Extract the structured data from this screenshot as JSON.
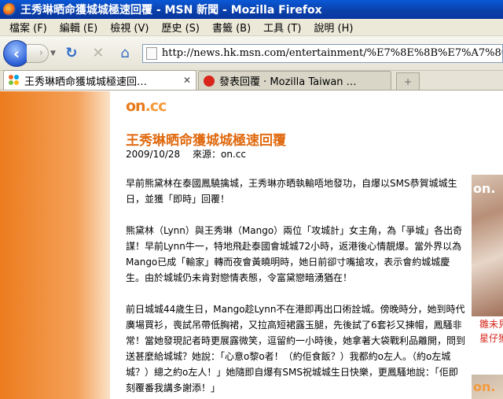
{
  "window": {
    "title": "王秀琳晒命獲城城極速回覆 - MSN 新聞 - Mozilla Firefox"
  },
  "menubar": {
    "items": [
      "檔案 (F)",
      "編輯 (E)",
      "檢視 (V)",
      "歷史 (S)",
      "書籤 (B)",
      "工具 (T)",
      "說明 (H)"
    ]
  },
  "navbar": {
    "url": "http://news.hk.msn.com/entertainment/%E7%8E%8B%E7%A7%80%E7"
  },
  "tabs": [
    {
      "label": "王秀琳晒命獲城城極速回…",
      "active": true
    },
    {
      "label": "發表回覆 · Mozilla Taiwan …",
      "active": false
    }
  ],
  "page": {
    "logo_on": "on",
    "logo_cc": ".cc",
    "title": "王秀琳晒命獲城城極速回覆",
    "date": "2009/10/28",
    "source_label": "來源：on.cc",
    "paragraphs": [
      "早前熊黛林在泰國鳳驍擒城，王秀琳亦晒執輸唔地發功，自爆以SMS恭賀城城生日，並獲「即時」回覆！",
      "熊黛林（Lynn）與王秀琳（Mango）兩位「攻城計」女主角，為「爭城」各出奇謀！早前Lynn牛一，特地飛赴泰國會城城72小時，返港後心情靚爆。當外界以為Mango已成「輸家」轉而夜會黃曉明時，她日前卻寸嘴搶攻，表示會約城城慶生。由於城城仍未肯對戀情表態，令富黛戀暗湧猶在！",
      "前日城城44歲生日，Mango趁Lynn不在港即再出口術詮城。傍晚時分，她到時代廣場買衫，喪試吊帶低胸裙，又拉高短裙露玉腿，先後試了6套衫又揀帽，鳳騷非常！當她發現記者時更展露微笑，逗留約一小時後，她拿著大袋戰利品離開，問到送甚麼給城城？她說：「心意o黎o者！（約佢食飯？）我都約o左人。（約o左城城？）總之約o左人！」她隨即自爆有SMS祝城城生日快樂，更鳳騷地說：「佢即刻覆番我講多謝添！」"
    ],
    "side_ad": {
      "logo": "on.",
      "caption_line1": "雛未見",
      "caption_line2": "星仔獲"
    },
    "side_ad2": {
      "logo": "on."
    }
  }
}
